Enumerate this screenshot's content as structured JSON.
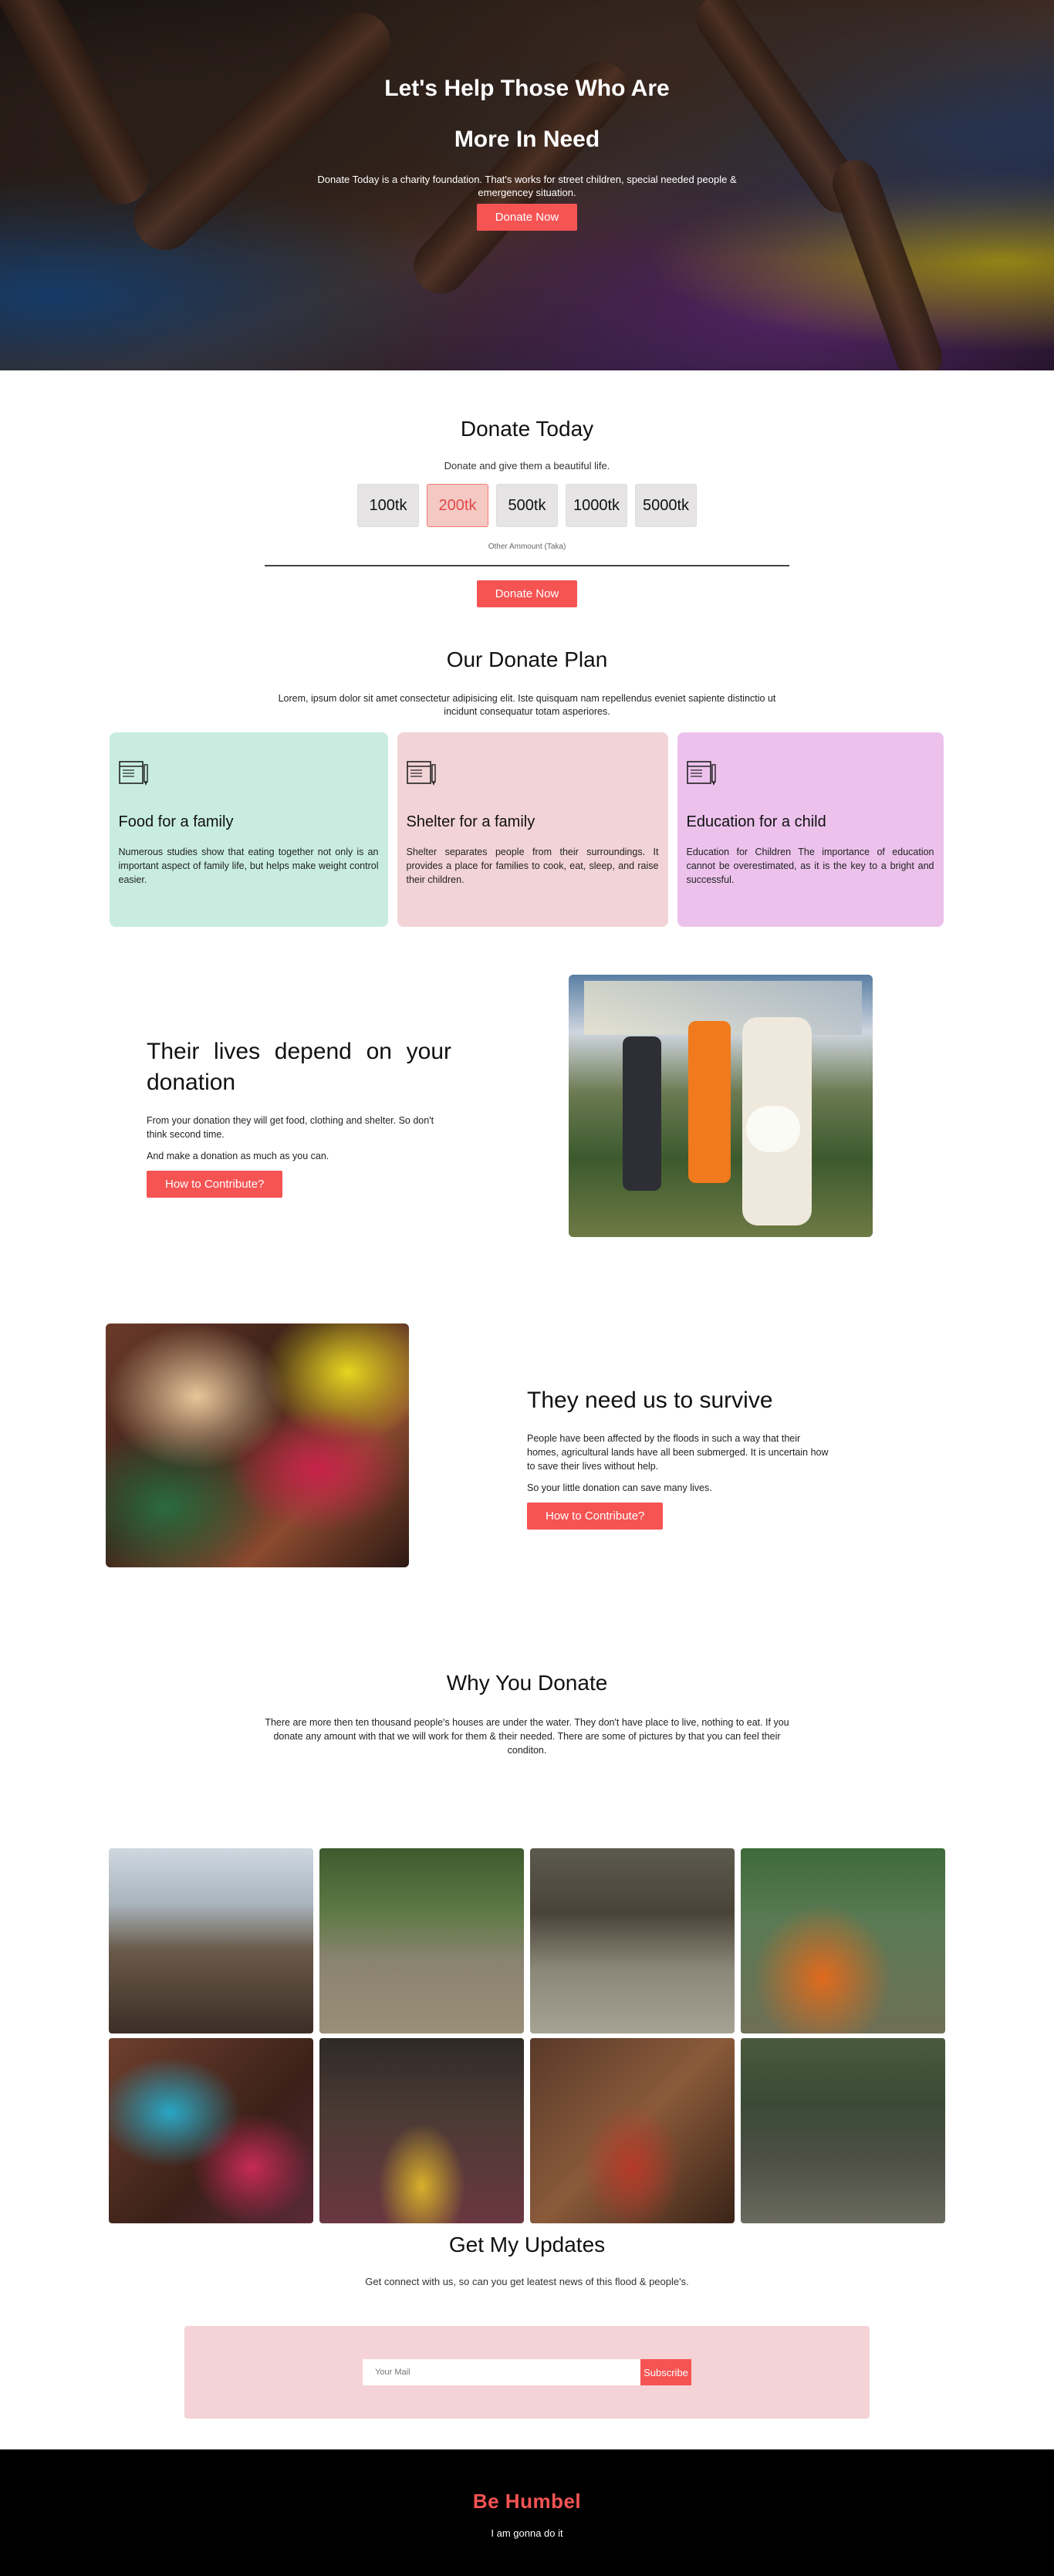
{
  "hero": {
    "title": "Let's Help Those Who Are More In Need",
    "text": "Donate Today is a charity foundation. That's works for street children, special needed people & emergencey situation.",
    "button": "Donate Now"
  },
  "donate": {
    "title": "Donate Today",
    "subtitle": "Donate and give them a beautiful life.",
    "amounts": [
      "100tk",
      "200tk",
      "500tk",
      "1000tk",
      "5000tk"
    ],
    "selected_amount": "200tk",
    "other_label": "Other Ammount (Taka)",
    "button": "Donate Now"
  },
  "plan": {
    "title": "Our Donate Plan",
    "description": "Lorem, ipsum dolor sit amet consectetur adipisicing elit. Iste quisquam nam repellendus eveniet sapiente distinctio ut incidunt consequatur totam asperiores.",
    "cards": [
      {
        "title": "Food for a family",
        "text": "Numerous studies show that eating together not only is an important aspect of family life, but helps make weight control easier.",
        "color": "#c8ede0",
        "icon": "document-pencil-icon"
      },
      {
        "title": "Shelter for a family",
        "text": "Shelter separates people from their surroundings. It provides a place for families to cook, eat, sleep, and raise their children.",
        "color": "#f2d3d6",
        "icon": "document-pencil-icon"
      },
      {
        "title": "Education for a child",
        "text": "Education for Children The importance of education cannot be overestimated, as it is the key to a bright and successful.",
        "color": "#ecc2ec",
        "icon": "document-pencil-icon"
      }
    ]
  },
  "feature1": {
    "title": "Their lives depend on your donation",
    "text": "From your donation they will get food, clothing and shelter. So don't think second time.",
    "text2": "And make a donation as much as you can.",
    "button": "How to Contribute?"
  },
  "feature2": {
    "title": "They need us to survive",
    "text": "People have been affected by the floods in such a way that their homes, agricultural lands have all been submerged. It is uncertain how to save their lives without help.",
    "text2": "So your little donation can save many lives.",
    "button": "How to Contribute?"
  },
  "why": {
    "title": "Why You Donate",
    "text": "There are more then ten thousand people's houses are under the water. They don't have place to live, nothing to eat. If you donate any amount with that we will work for them & their needed. There are some of pictures by that you can feel their conditon."
  },
  "updates": {
    "title": "Get My Updates",
    "subtitle": "Get connect with us, so can you get leatest news of this flood & people's.",
    "input_placeholder": "Your Mail",
    "button": "Subscribe"
  },
  "footer": {
    "brand": "Be Humbel",
    "tagline": "I am gonna do it"
  },
  "colors": {
    "accent": "#f65353",
    "footer_bg": "#000000"
  }
}
